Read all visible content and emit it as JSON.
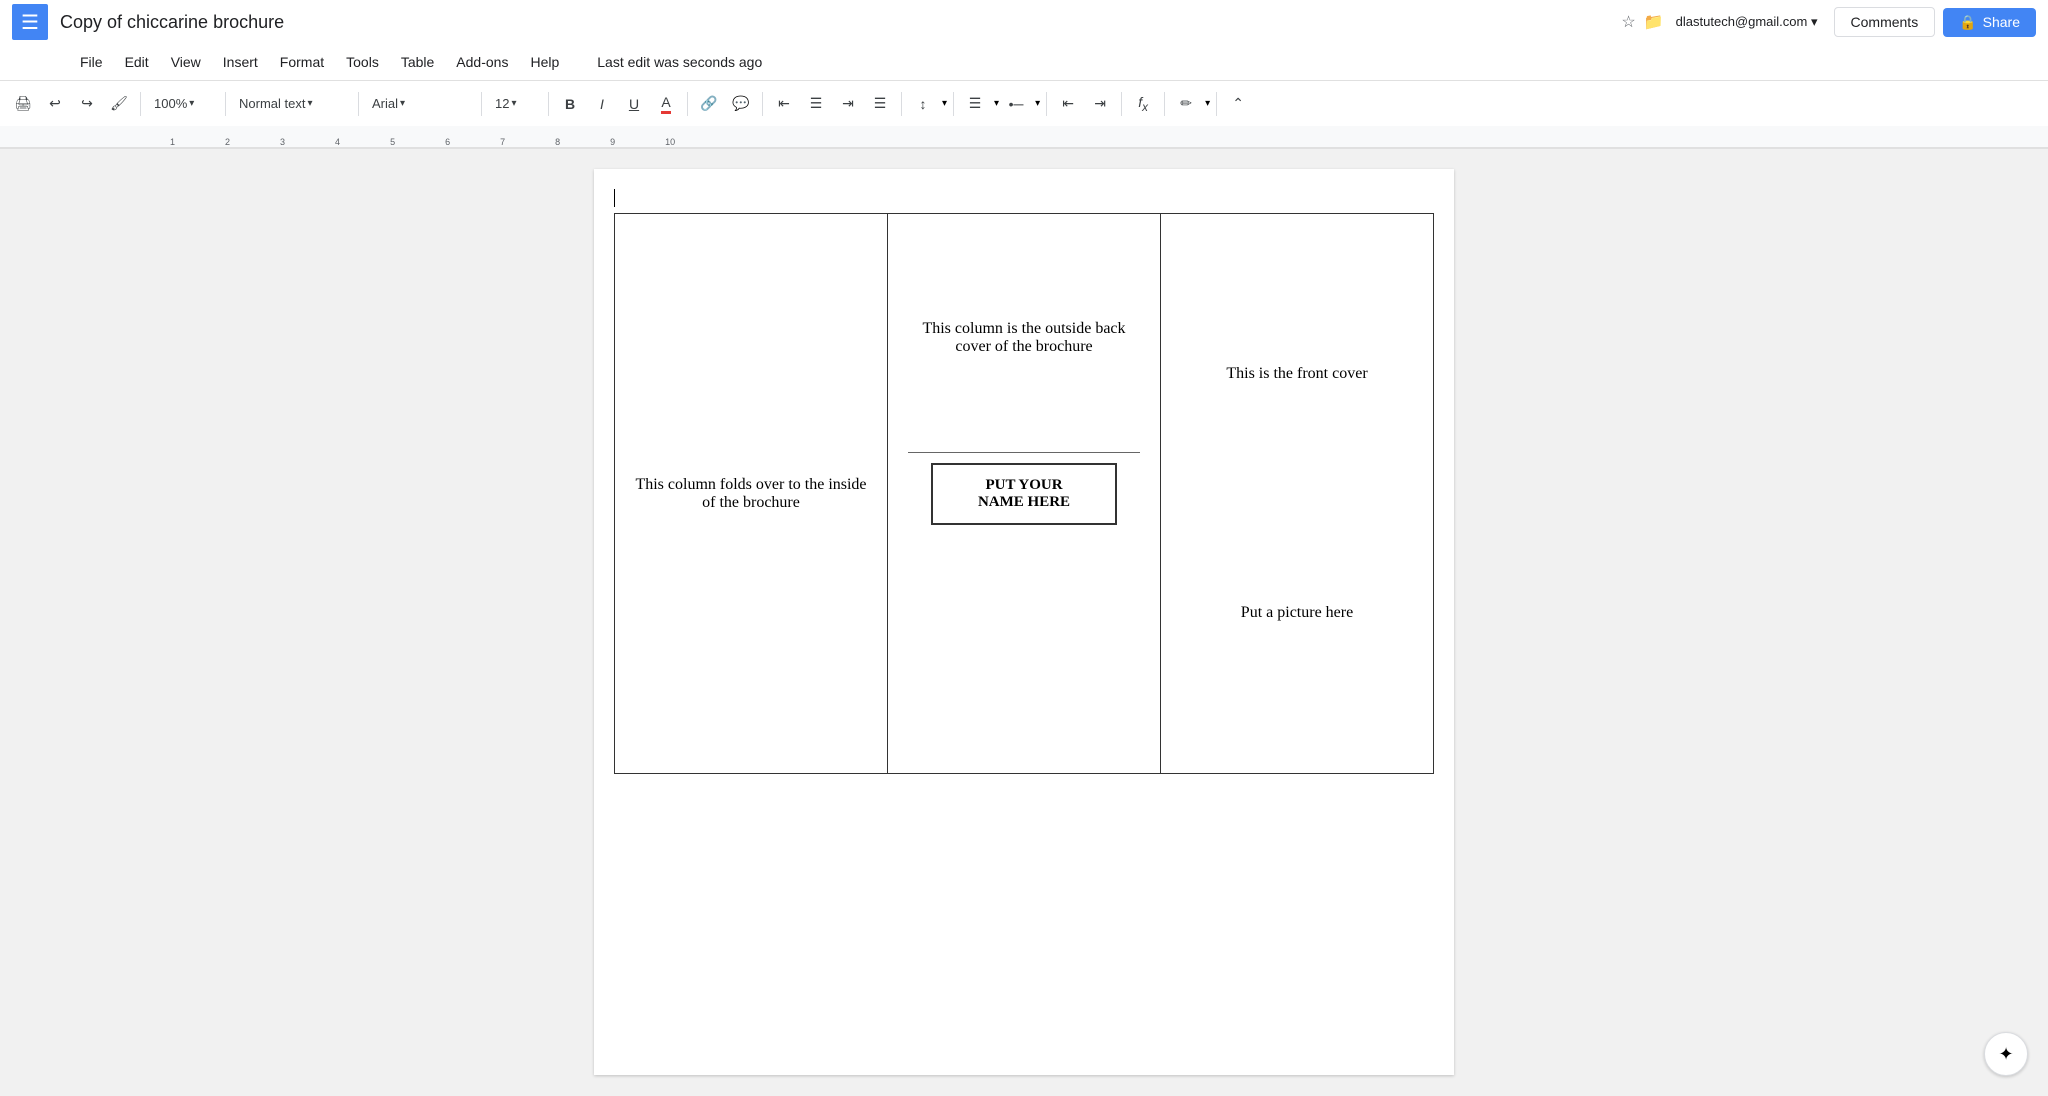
{
  "app": {
    "menu_icon": "☰",
    "title": "Copy of chiccarine brochure",
    "star_icon": "☆",
    "folder_icon": "📁",
    "user_email": "dlastutech@gmail.com",
    "dropdown_icon": "▾",
    "comments_label": "Comments",
    "share_icon": "🔒",
    "share_label": "Share"
  },
  "menu": {
    "items": [
      "File",
      "Edit",
      "View",
      "Insert",
      "Format",
      "Tools",
      "Table",
      "Add-ons",
      "Help"
    ],
    "last_edit": "Last edit was seconds ago"
  },
  "toolbar": {
    "print": "🖨",
    "undo": "↩",
    "redo": "↪",
    "paint_format": "🖌",
    "zoom": "100%",
    "style": "Normal text",
    "font": "Arial",
    "font_size": "12",
    "bold": "B",
    "italic": "I",
    "underline": "U",
    "font_color": "A",
    "link": "🔗",
    "comment": "💬",
    "align_left": "≡",
    "align_center": "≡",
    "align_right": "≡",
    "align_justify": "≡",
    "line_spacing": "↕",
    "numbered_list": "1.",
    "bulleted_list": "•",
    "decrease_indent": "⇤",
    "increase_indent": "⇥",
    "formula": "fx",
    "pen": "✏",
    "collapse": "⌃"
  },
  "document": {
    "col1_text": "This column folds over to the inside of the brochure",
    "col2_text": "This column is the outside back cover of the brochure",
    "col2_name_line1": "PUT YOUR",
    "col2_name_line2": "NAME HERE",
    "col3_top_text": "This is the front cover",
    "col3_bottom_text": "Put a picture here"
  },
  "colors": {
    "blue": "#4285f4",
    "text": "#202124",
    "light_gray": "#f1f1f1",
    "border": "#dadce0"
  }
}
